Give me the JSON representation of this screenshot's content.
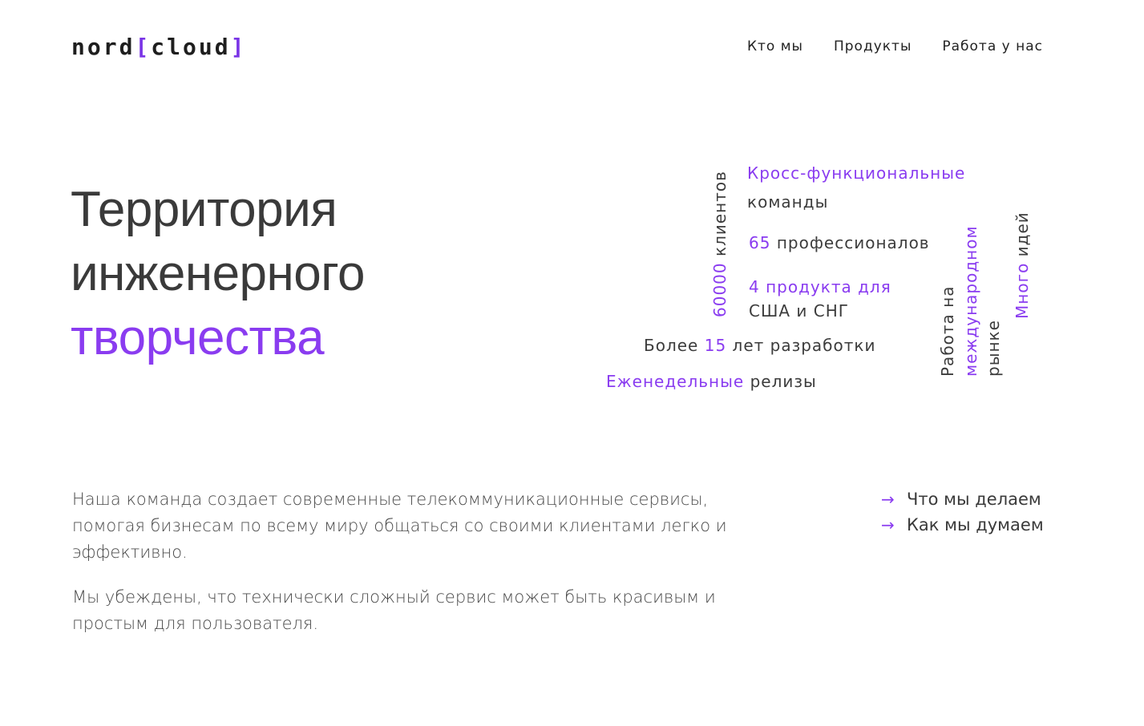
{
  "header": {
    "logo": {
      "left": "nord",
      "open": "[",
      "right": "cloud",
      "close": "]"
    },
    "nav": [
      "Кто мы",
      "Продукты",
      "Работа у нас"
    ]
  },
  "hero": {
    "line1": "Территория",
    "line2": "инженерного",
    "line3": "творчества"
  },
  "cloud": {
    "clients_num": "60000",
    "clients_text": "клиентов",
    "cross_func": "Кросс-функциональные",
    "teams": "команды",
    "pros_num": "65",
    "pros_text": "профессионалов",
    "products_line1": "4 продукта для",
    "products_line2": "США и СНГ",
    "years_pre": "Более",
    "years_num": "15",
    "years_post": "лет разработки",
    "weekly": "Еженедельные",
    "releases": "релизы",
    "intl_1": "Работа на",
    "intl_2": "международном",
    "intl_3": "рынке",
    "ideas_1": "Много",
    "ideas_2": "идей"
  },
  "main": {
    "para1": "Наша команда создает современные телекоммуникационные сервисы, помогая бизнесам по всему миру общаться со своими клиентами легко и эффективно.",
    "para2": "Мы убеждены, что технически сложный сервис может быть красивым и простым для пользователя."
  },
  "links": [
    {
      "arrow": "→",
      "label": "Что мы делаем"
    },
    {
      "arrow": "→",
      "label": "Как мы думаем"
    }
  ],
  "colors": {
    "accent": "#8a3cf0",
    "text": "#3a3a3a"
  }
}
